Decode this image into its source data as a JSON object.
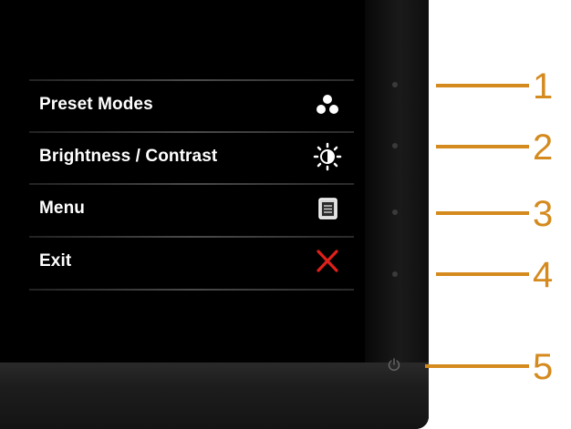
{
  "osd": {
    "items": [
      {
        "label": "Preset Modes",
        "icon": "preset-modes-icon"
      },
      {
        "label": "Brightness / Contrast",
        "icon": "brightness-contrast-icon"
      },
      {
        "label": "Menu",
        "icon": "menu-icon"
      },
      {
        "label": "Exit",
        "icon": "exit-icon"
      }
    ]
  },
  "callouts": [
    "1",
    "2",
    "3",
    "4",
    "5"
  ],
  "colors": {
    "callout": "#d58a1e",
    "exit": "#e0201a",
    "text": "#ffffff"
  }
}
